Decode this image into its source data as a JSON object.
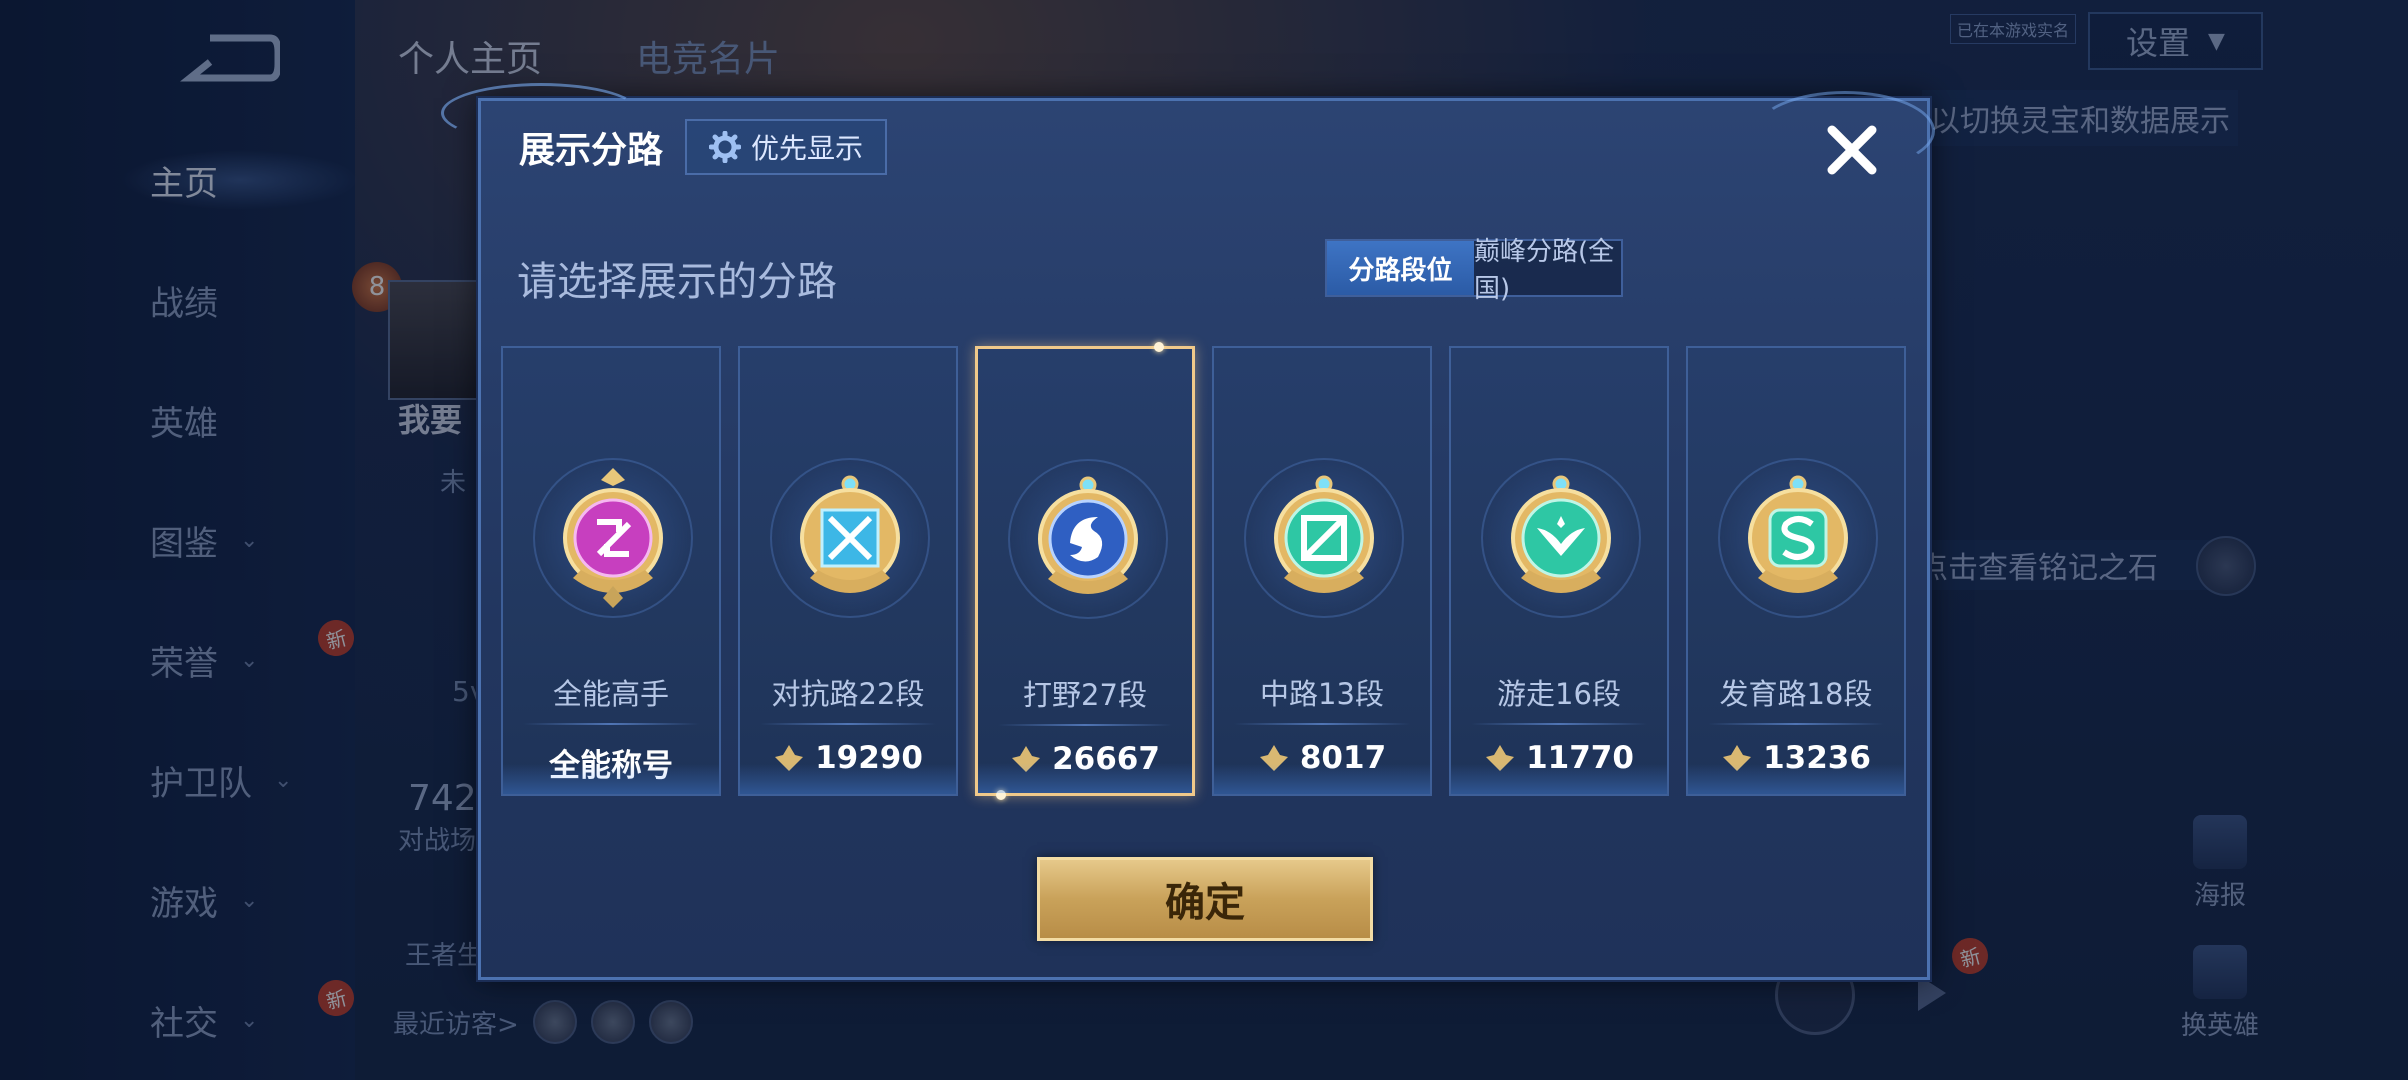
{
  "background": {
    "back_label": "",
    "top_tabs": [
      "个人主页",
      "电竞名片"
    ],
    "sidebar": [
      {
        "label": "主页",
        "active": true
      },
      {
        "label": "战绩"
      },
      {
        "label": "英雄"
      },
      {
        "label": "图鉴",
        "arrow": true
      },
      {
        "label": "荣誉",
        "arrow": true,
        "badge": "新"
      },
      {
        "label": "护卫队",
        "arrow": true
      },
      {
        "label": "游戏",
        "arrow": true
      },
      {
        "label": "社交",
        "arrow": true,
        "badge": "新"
      }
    ],
    "settings_label": "设置",
    "verify_tag": "已在本游戏实名",
    "hint_right": "以切换灵宝和数据展示",
    "mingwen_hint": "点击查看铭记之石",
    "poster_label": "海报",
    "switch_hero_label": "换英雄",
    "new_badge": "新",
    "visitors_label": "最近访客>",
    "level": "8",
    "name_partial": "我要",
    "unknown_partial": "未",
    "mode_partial": "5v",
    "count_partial": "742",
    "count_label_partial": "对战场",
    "king_partial": "王者生"
  },
  "modal": {
    "title": "展示分路",
    "priority_label": "优先显示",
    "prompt": "请选择展示的分路",
    "toggles": [
      {
        "label": "分路段位",
        "active": true
      },
      {
        "label": "巅峰分路(全国)",
        "active": false
      }
    ],
    "cards": [
      {
        "rank": "全能高手",
        "score": "全能称号",
        "has_icon": false,
        "selected": false,
        "emblem": "allround-emblem",
        "color": "#c73fbf"
      },
      {
        "rank": "对抗路22段",
        "score": "19290",
        "has_icon": true,
        "selected": false,
        "emblem": "clash-lane-emblem",
        "color": "#3db7e6"
      },
      {
        "rank": "打野27段",
        "score": "26667",
        "has_icon": true,
        "selected": true,
        "emblem": "jungle-emblem",
        "color": "#3d6fd1"
      },
      {
        "rank": "中路13段",
        "score": "8017",
        "has_icon": true,
        "selected": false,
        "emblem": "mid-lane-emblem",
        "color": "#2ec7a4"
      },
      {
        "rank": "游走16段",
        "score": "11770",
        "has_icon": true,
        "selected": false,
        "emblem": "roam-emblem",
        "color": "#2ec7a4"
      },
      {
        "rank": "发育路18段",
        "score": "13236",
        "has_icon": true,
        "selected": false,
        "emblem": "farm-lane-emblem",
        "color": "#2ec7a4"
      }
    ],
    "confirm_label": "确定"
  }
}
